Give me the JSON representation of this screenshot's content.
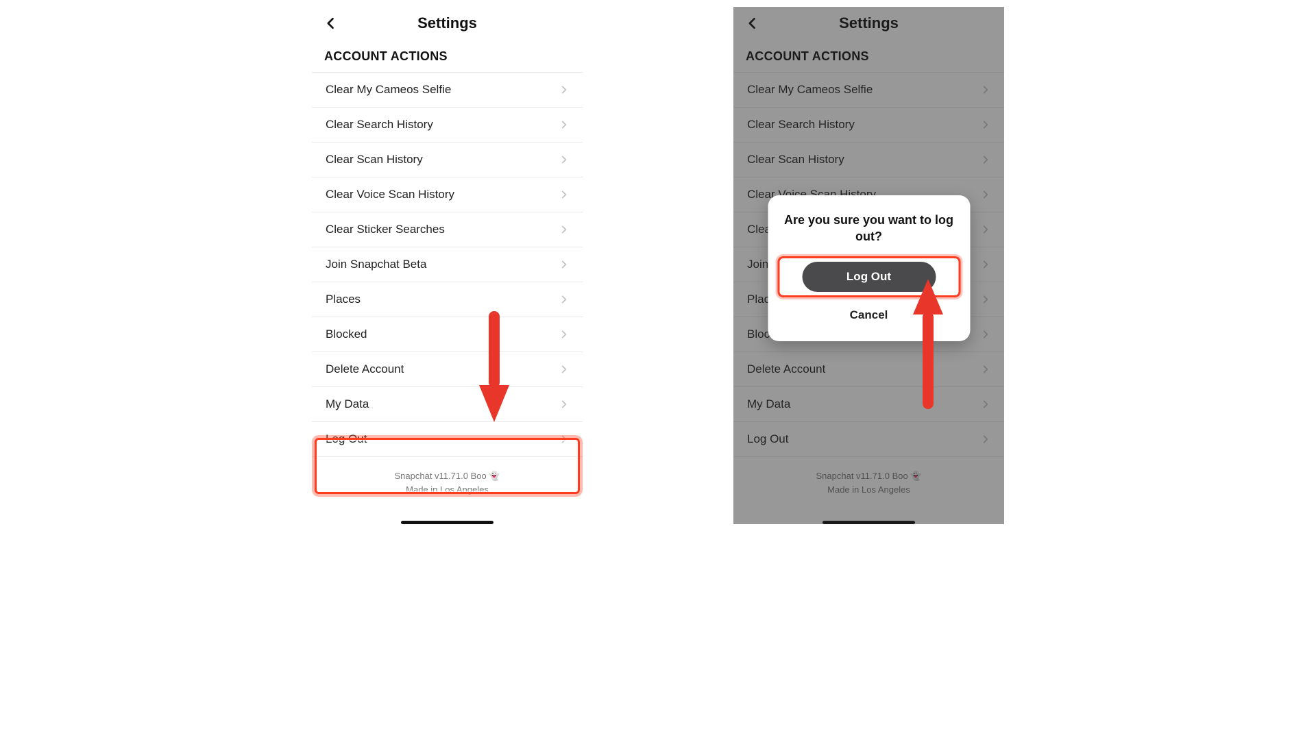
{
  "header": {
    "title": "Settings"
  },
  "section": {
    "label": "ACCOUNT ACTIONS"
  },
  "rows": [
    {
      "label": "Clear My Cameos Selfie"
    },
    {
      "label": "Clear Search History"
    },
    {
      "label": "Clear Scan History"
    },
    {
      "label": "Clear Voice Scan History"
    },
    {
      "label": "Clear Sticker Searches"
    },
    {
      "label": "Join Snapchat Beta"
    },
    {
      "label": "Places"
    },
    {
      "label": "Blocked"
    },
    {
      "label": "Delete Account"
    },
    {
      "label": "My Data"
    },
    {
      "label": "Log Out"
    }
  ],
  "footer": {
    "line1": "Snapchat v11.71.0 Boo 👻",
    "line2": "Made in Los Angeles"
  },
  "modal": {
    "title": "Are you sure you want to log out?",
    "confirm": "Log Out",
    "cancel": "Cancel"
  },
  "annotations": {
    "highlight_row_index": 10,
    "arrow_color": "#e8362a"
  }
}
